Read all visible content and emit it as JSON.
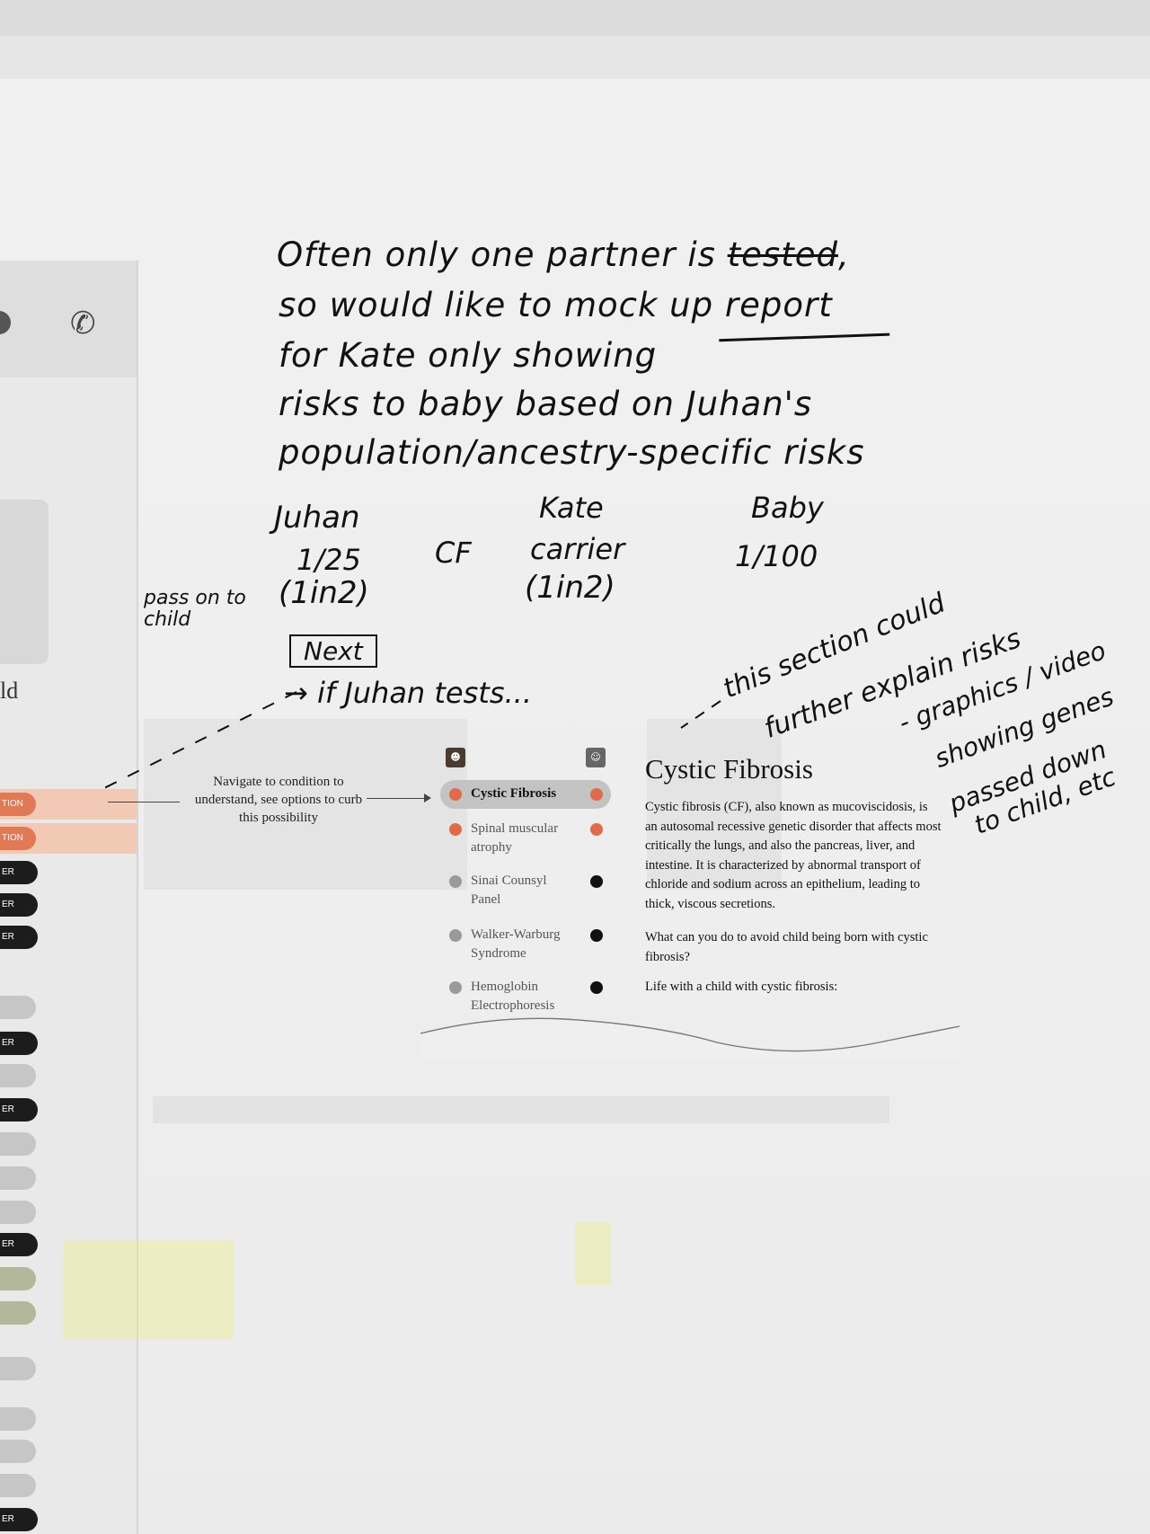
{
  "note": {
    "lines": [
      "Often only one partner is tested,",
      "so would like to mock up report",
      "for Kate only showing",
      "risks to baby based on Juhan's",
      "population/ancestry-specific risks"
    ],
    "struck_word": "tested"
  },
  "risk_table": {
    "juhan": {
      "header": "Juhan",
      "value": "1/25",
      "ratio": "(1in2)"
    },
    "condition": "CF",
    "kate": {
      "header": "Kate",
      "value": "carrier",
      "ratio": "(1in2)"
    },
    "baby": {
      "header": "Baby",
      "value": "1/100"
    },
    "pass_on_label": "pass on to child"
  },
  "next_box": "Next",
  "if_tests": "→ if Juhan tests...",
  "side_note": {
    "lines": [
      "this section could",
      "further explain risks",
      "- graphics / video",
      "showing genes",
      "passed down",
      "to child, etc"
    ]
  },
  "callout_text": "Navigate to condition to understand, see options to curb this possibility",
  "conditions": [
    {
      "label": "Cystic Fibrosis",
      "selected": true,
      "left_color": "#e06a4a",
      "right_color": "#e06a4a"
    },
    {
      "label": "Spinal muscular atrophy",
      "selected": false,
      "left_color": "#e06a4a",
      "right_color": "#e06a4a"
    },
    {
      "label": "Sinai Counsyl Panel",
      "selected": false,
      "left_color": "#9a9a9a",
      "right_color": "#111111"
    },
    {
      "label": "Walker-Warburg Syndrome",
      "selected": false,
      "left_color": "#9a9a9a",
      "right_color": "#111111"
    },
    {
      "label": "Hemoglobin Electrophoresis",
      "selected": false,
      "left_color": "#9a9a9a",
      "right_color": "#111111"
    }
  ],
  "detail": {
    "title": "Cystic Fibrosis",
    "body": "Cystic fibrosis (CF), also known as mucoviscidosis, is an autosomal recessive genetic disorder that affects most critically the lungs, and also the pancreas, liver, and intestine. It is characterized by abnormal transport of chloride and sodium across an epithelium, leading to thick, viscous secretions.",
    "question": "What can you do to avoid child being born with cystic fibrosis?",
    "life": "Life with a child with cystic fibrosis:"
  },
  "sidebar": {
    "partial_text": "ld",
    "orange_pill": "TION",
    "dark_pill": "ER",
    "phone_icon": "phone-icon"
  }
}
